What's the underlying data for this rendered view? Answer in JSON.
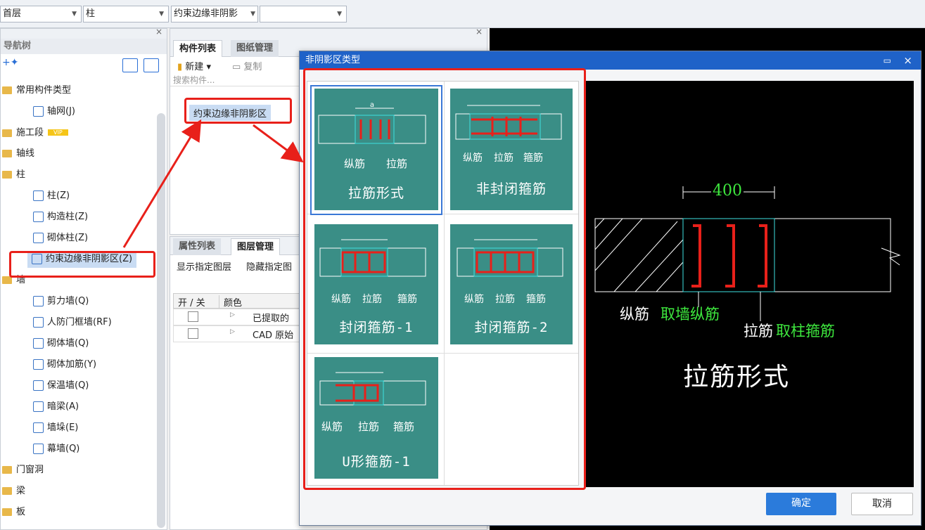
{
  "toolbar": {
    "floor": "首层",
    "type": "柱",
    "component": "约束边缘非阴影",
    "extra": ""
  },
  "nav": {
    "title": "导航树",
    "items": [
      {
        "label": "常用构件类型",
        "kind": "group"
      },
      {
        "label": "轴网(J)",
        "kind": "child"
      },
      {
        "label": "施工段",
        "kind": "group",
        "badge": "VIP"
      },
      {
        "label": "轴线",
        "kind": "group"
      },
      {
        "label": "柱",
        "kind": "group"
      },
      {
        "label": "柱(Z)",
        "kind": "child"
      },
      {
        "label": "构造柱(Z)",
        "kind": "child"
      },
      {
        "label": "砌体柱(Z)",
        "kind": "child"
      },
      {
        "label": "约束边缘非阴影区(Z)",
        "kind": "child",
        "selected": true
      },
      {
        "label": "墙",
        "kind": "group"
      },
      {
        "label": "剪力墙(Q)",
        "kind": "child"
      },
      {
        "label": "人防门框墙(RF)",
        "kind": "child"
      },
      {
        "label": "砌体墙(Q)",
        "kind": "child"
      },
      {
        "label": "砌体加筋(Y)",
        "kind": "child"
      },
      {
        "label": "保温墙(Q)",
        "kind": "child"
      },
      {
        "label": "暗梁(A)",
        "kind": "child"
      },
      {
        "label": "墙垛(E)",
        "kind": "child"
      },
      {
        "label": "幕墙(Q)",
        "kind": "child"
      },
      {
        "label": "门窗洞",
        "kind": "group"
      },
      {
        "label": "梁",
        "kind": "group"
      },
      {
        "label": "板",
        "kind": "group"
      }
    ]
  },
  "complist": {
    "tabs": [
      "构件列表",
      "图纸管理"
    ],
    "new_label": "新建",
    "copy_label": "复制",
    "search_placeholder": "搜索构件...",
    "item": "约束边缘非阴影区"
  },
  "props": {
    "tabs": [
      "属性列表",
      "图层管理"
    ],
    "show_layer": "显示指定图层",
    "hide_layer": "隐藏指定图",
    "col_onoff": "开 / 关",
    "col_color": "颜色",
    "rows": [
      "已提取的",
      "CAD 原始"
    ]
  },
  "dialog": {
    "title": "非阴影区类型",
    "cards": [
      {
        "label": "拉筋形式",
        "tags": [
          "纵筋",
          "拉筋"
        ],
        "dims": "a"
      },
      {
        "label": "非封闭箍筋",
        "tags": [
          "纵筋",
          "拉筋",
          "箍筋"
        ],
        "dims": "a b a"
      },
      {
        "label": "封闭箍筋-1",
        "tags": [
          "纵筋",
          "拉筋",
          "箍筋"
        ],
        "dims": "a b"
      },
      {
        "label": "封闭箍筋-2",
        "tags": [
          "纵筋",
          "拉筋",
          "箍筋"
        ],
        "dims": "a b a"
      },
      {
        "label": "U形箍筋-1",
        "tags": [
          "纵筋",
          "拉筋",
          "箍筋"
        ],
        "dims": "a b"
      }
    ],
    "preview": {
      "dim": "400",
      "zongjin": "纵筋",
      "zongjin_note": "取墙纵筋",
      "lajin": "拉筋",
      "lajin_note": "取柱箍筋",
      "title": "拉筋形式"
    },
    "ok_label": "确定",
    "cancel_label": "取消"
  },
  "colors": {
    "accent": "#1f62c8",
    "card": "#3a8e86",
    "highlight": "#e8201a"
  }
}
